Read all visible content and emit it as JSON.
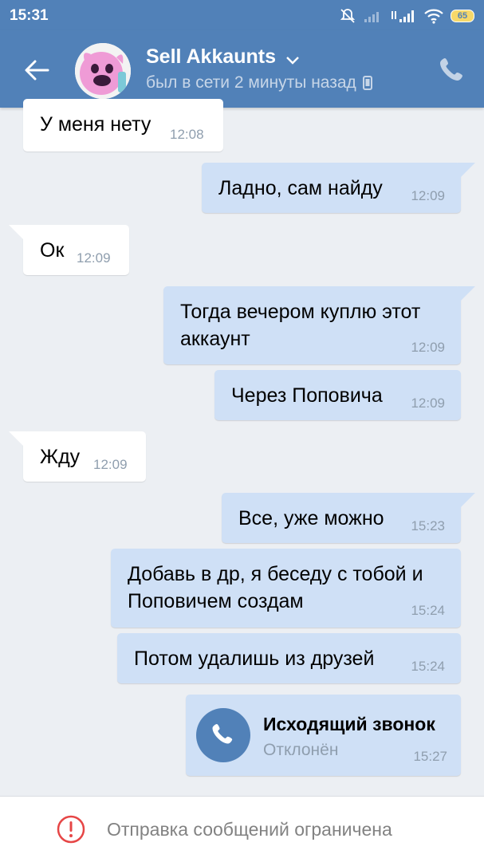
{
  "status_bar": {
    "time": "15:31",
    "battery": "65",
    "icons": [
      "mute-icon",
      "signal-icon",
      "signal-icon",
      "wifi-icon",
      "battery-icon"
    ]
  },
  "header": {
    "title": "Sell Akkaunts",
    "subtitle": "был в сети 2 минуты назад",
    "icons": [
      "back-arrow-icon",
      "chevron-down-icon",
      "mobile-icon",
      "phone-icon"
    ]
  },
  "messages": [
    {
      "dir": "in",
      "text": "У меня нету",
      "time": "12:08"
    },
    {
      "dir": "out",
      "text": "Ладно, сам найду",
      "time": "12:09"
    },
    {
      "dir": "in",
      "text": "Ок",
      "time": "12:09"
    },
    {
      "dir": "out",
      "text_line1": "Тогда вечером куплю этот",
      "text_line2": "аккаунт",
      "time": "12:09"
    },
    {
      "dir": "out",
      "text": "Через Поповича",
      "time": "12:09"
    },
    {
      "dir": "in",
      "text": "Жду",
      "time": "12:09"
    },
    {
      "dir": "out",
      "text": "Все, уже можно",
      "time": "15:23"
    },
    {
      "dir": "out",
      "text_line1": "Добавь в др, я беседу с тобой и",
      "text_line2": "Поповичем создам",
      "time": "15:24"
    },
    {
      "dir": "out",
      "text": "Потом удалишь из друзей",
      "time": "15:24"
    }
  ],
  "call": {
    "title": "Исходящий звонок",
    "status": "Отклонён",
    "time": "15:27"
  },
  "bottom_bar": {
    "text": "Отправка сообщений ограничена"
  },
  "colors": {
    "header": "#5181b8",
    "background": "#eceff3",
    "outgoing_bubble": "#cfe0f6",
    "incoming_bubble": "#ffffff",
    "warning": "#e64646"
  }
}
